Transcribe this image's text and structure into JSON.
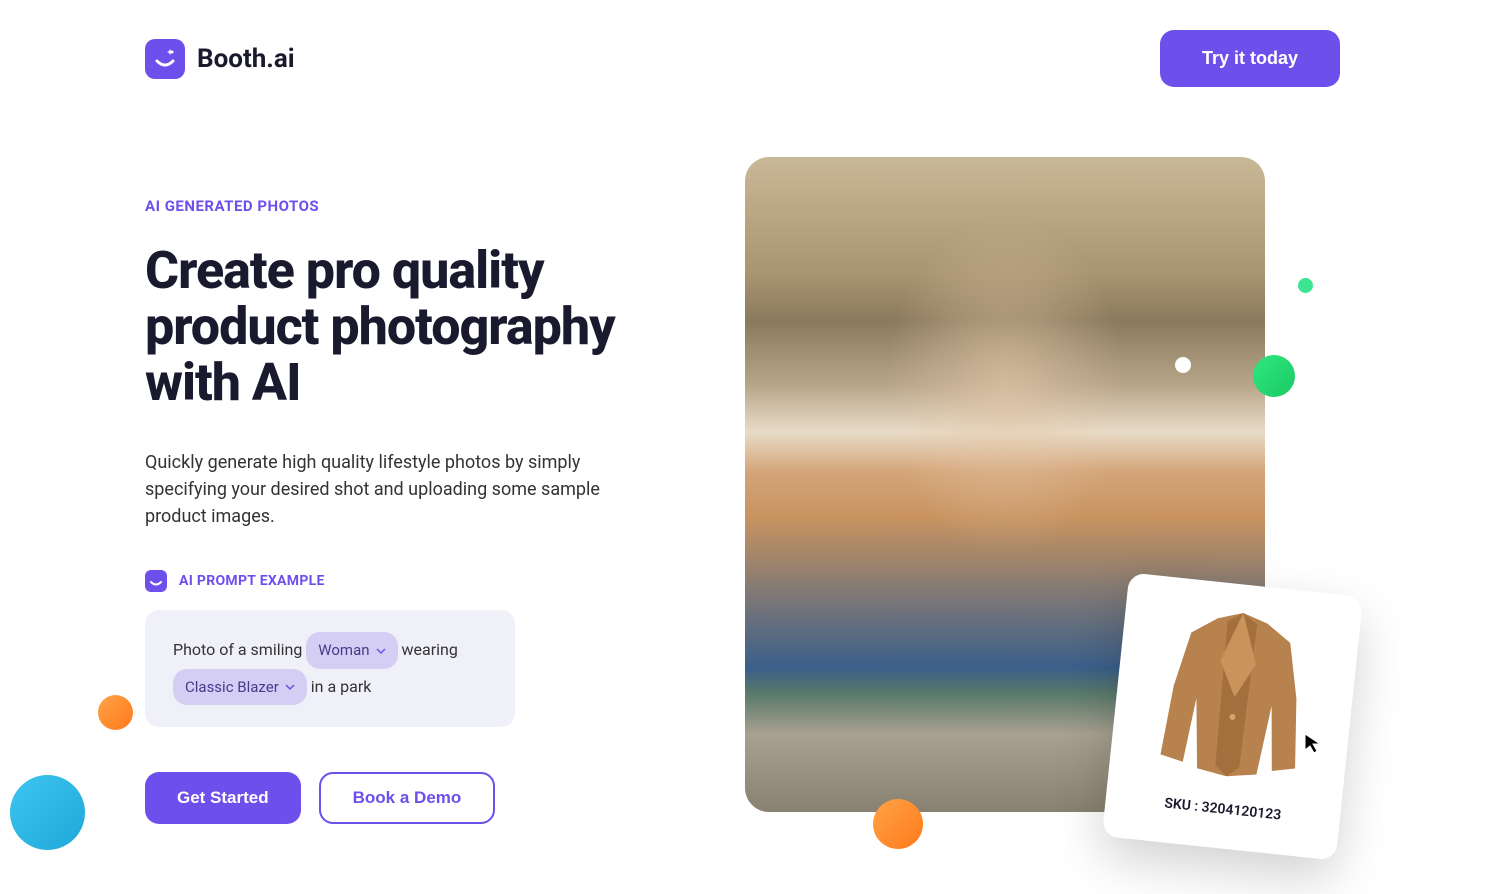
{
  "brand": {
    "name": "Booth.ai"
  },
  "header": {
    "cta": "Try it today"
  },
  "hero": {
    "eyebrow": "AI GENERATED PHOTOS",
    "headline": "Create pro quality product photography with AI",
    "description": "Quickly generate high quality lifestyle photos by simply specifying your desired shot and uploading some sample product images.",
    "prompt": {
      "label": "AI PROMPT EXAMPLE",
      "text_before": "Photo of a smiling",
      "chip1": "Woman",
      "text_mid": "wearing",
      "chip2": "Classic Blazer",
      "text_after": "in a park"
    },
    "actions": {
      "primary": "Get Started",
      "secondary": "Book a Demo"
    }
  },
  "product_card": {
    "sku_label": "SKU : 3204120123"
  }
}
